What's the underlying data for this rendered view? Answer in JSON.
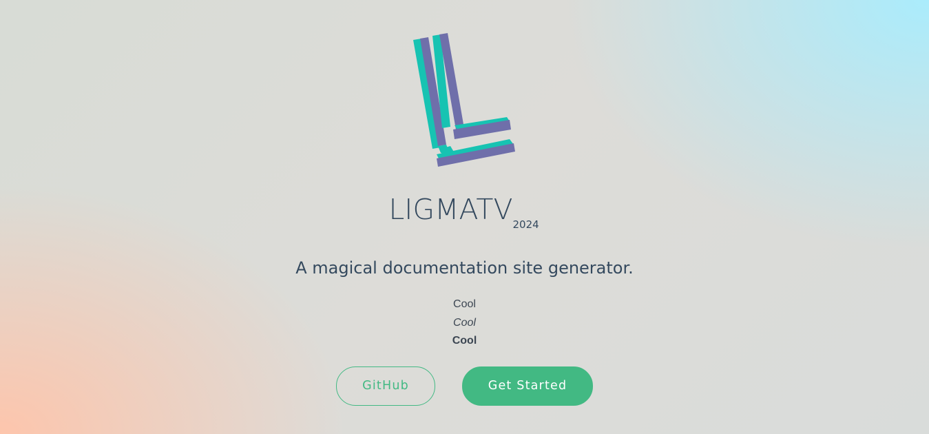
{
  "colors": {
    "accent": "#42b983",
    "text": "#34495e",
    "logo_purple": "#6f6faa",
    "logo_teal": "#17c3b2"
  },
  "logo": {
    "name": "ligmatv-logo",
    "icon": "L-letter-logo"
  },
  "title": {
    "text": "LIGMATV",
    "version": "2024"
  },
  "tagline": "A magical documentation site generator.",
  "cool_lines": {
    "normal": "Cool",
    "italic": "Cool",
    "bold": "Cool"
  },
  "buttons": {
    "github": "GitHub",
    "get_started": "Get Started"
  }
}
